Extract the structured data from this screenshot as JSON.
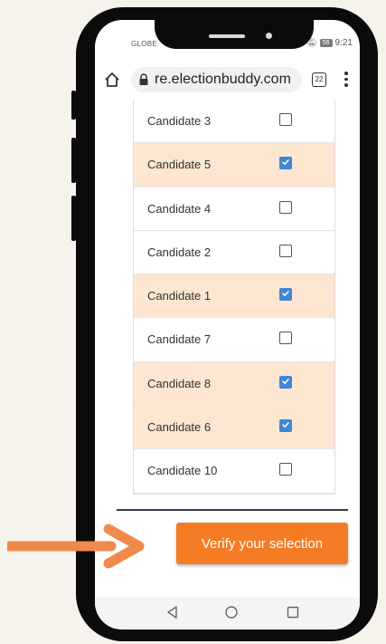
{
  "status_bar": {
    "carrier": "GLOBE",
    "battery": "56",
    "time": "9:21"
  },
  "browser": {
    "url": "re.electionbuddy.com",
    "tab_count": "22"
  },
  "candidates": [
    {
      "label": "Candidate 3",
      "checked": false
    },
    {
      "label": "Candidate 5",
      "checked": true
    },
    {
      "label": "Candidate 4",
      "checked": false
    },
    {
      "label": "Candidate 2",
      "checked": false
    },
    {
      "label": "Candidate 1",
      "checked": true
    },
    {
      "label": "Candidate 7",
      "checked": false
    },
    {
      "label": "Candidate 8",
      "checked": true
    },
    {
      "label": "Candidate 6",
      "checked": true
    },
    {
      "label": "Candidate 10",
      "checked": false
    }
  ],
  "verify_button": {
    "label": "Verify your selection"
  },
  "colors": {
    "accent": "#f47c25",
    "checked_row": "#fce6d1",
    "checkbox_checked": "#3f86d4",
    "background": "#f6f3ec"
  },
  "icons": {
    "home": "home-icon",
    "lock": "lock-icon",
    "menu": "more-vert-icon",
    "nav_back": "back-triangle-icon",
    "nav_home": "home-circle-icon",
    "nav_recent": "recent-square-icon",
    "annotation": "arrow-right-icon"
  }
}
